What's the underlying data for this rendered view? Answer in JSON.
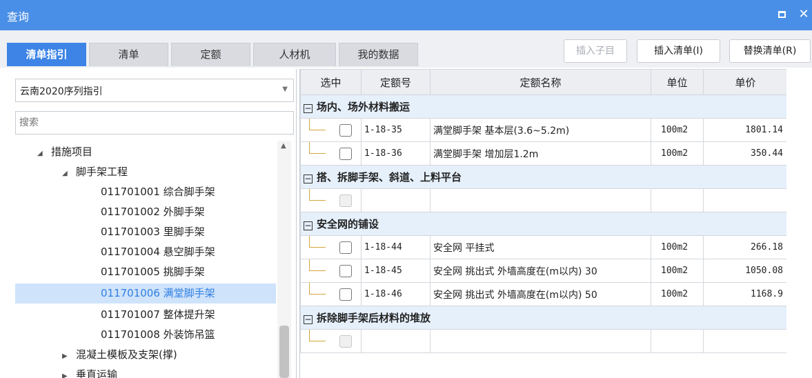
{
  "window": {
    "title": "查询"
  },
  "tabs": [
    "清单指引",
    "清单",
    "定额",
    "人材机",
    "我的数据"
  ],
  "toolbar": {
    "insert_child": "插入子目",
    "insert_list": "插入清单(I)",
    "replace_list": "替换清单(R)"
  },
  "left": {
    "select_value": "云南2020序列指引",
    "search_placeholder": "搜索",
    "tree": [
      {
        "label": "措施项目"
      },
      {
        "label": "脚手架工程"
      },
      {
        "label": "011701001  综合脚手架"
      },
      {
        "label": "011701002  外脚手架"
      },
      {
        "label": "011701003  里脚手架"
      },
      {
        "label": "011701004  悬空脚手架"
      },
      {
        "label": "011701005  挑脚手架"
      },
      {
        "label": "011701006  满堂脚手架"
      },
      {
        "label": "011701007  整体提升架"
      },
      {
        "label": "011701008  外装饰吊篮"
      },
      {
        "label": "混凝土模板及支架(撑)"
      },
      {
        "label": "垂直运输"
      }
    ]
  },
  "grid": {
    "columns": [
      "选中",
      "定额号",
      "定额名称",
      "单位",
      "单价"
    ],
    "groups": [
      {
        "title": "场内、场外材料搬运"
      },
      {
        "title": "搭、拆脚手架、斜道、上料平台"
      },
      {
        "title": "安全网的铺设"
      },
      {
        "title": "拆除脚手架后材料的堆放"
      }
    ],
    "rows": [
      {
        "code": "1-18-35",
        "name": "满堂脚手架 基本层(3.6~5.2m)",
        "unit": "100m2",
        "price": "1801.14"
      },
      {
        "code": "1-18-36",
        "name": "满堂脚手架 增加层1.2m",
        "unit": "100m2",
        "price": "350.44"
      },
      {
        "code": "1-18-44",
        "name": "安全网 平挂式",
        "unit": "100m2",
        "price": "266.18"
      },
      {
        "code": "1-18-45",
        "name": "安全网 挑出式 外墙高度在(m以内) 30",
        "unit": "100m2",
        "price": "1050.08"
      },
      {
        "code": "1-18-46",
        "name": "安全网 挑出式 外墙高度在(m以内) 50",
        "unit": "100m2",
        "price": "1168.9"
      }
    ]
  },
  "colors": {
    "accent": "#4a8fe7",
    "tab_active": "#3d84e6",
    "selected_row": "#cfe3fb",
    "group_row": "#e6f0fb"
  }
}
